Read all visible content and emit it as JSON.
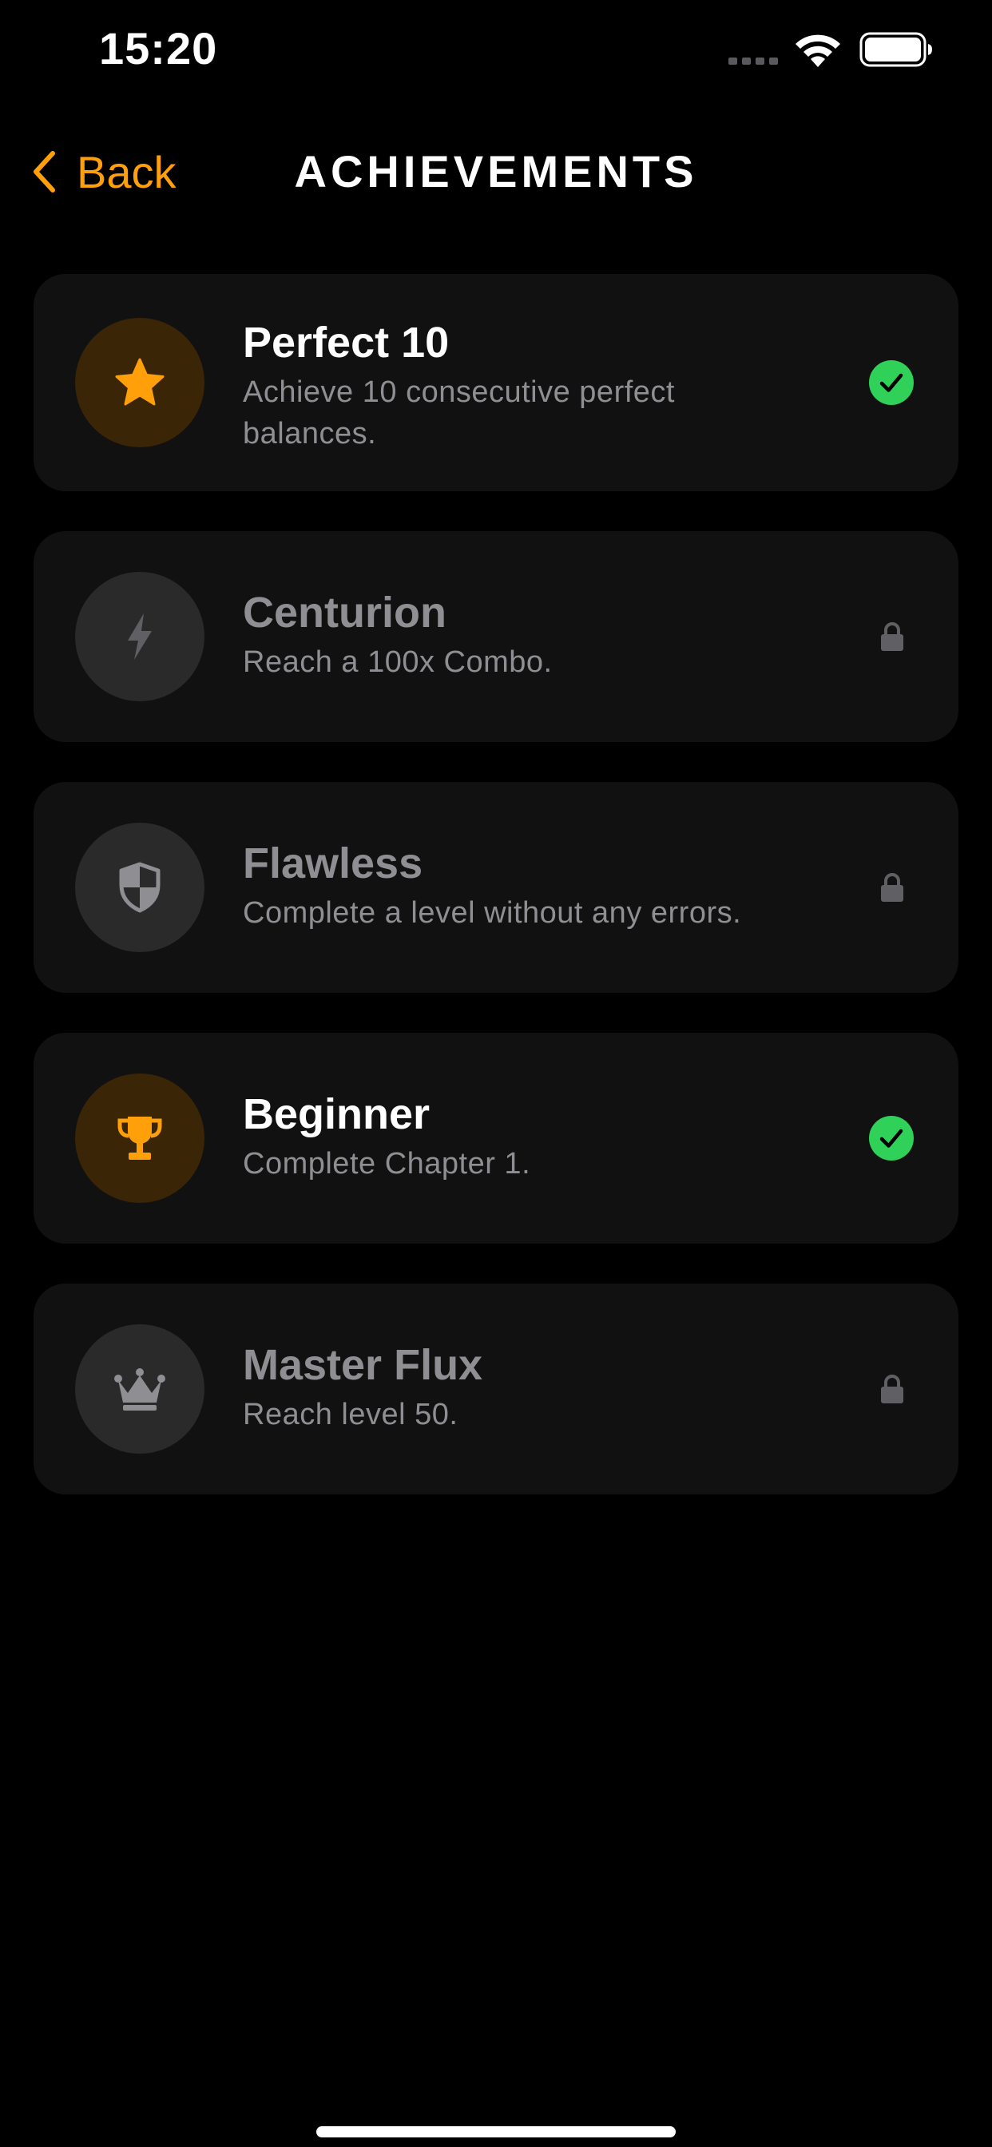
{
  "status_bar": {
    "time": "15:20",
    "icons": [
      "cellular-signal-icon",
      "wifi-icon",
      "battery-icon"
    ]
  },
  "nav": {
    "back_label": "Back",
    "back_icon": "chevron-left-icon",
    "title": "ACHIEVEMENTS"
  },
  "colors": {
    "accent": "#FF9F0A",
    "success": "#30D158",
    "locked_text": "#8E8E93",
    "card": "#111111",
    "background": "#000000"
  },
  "achievements": [
    {
      "title": "Perfect 10",
      "description": "Achieve 10 consecutive perfect balances.",
      "icon": "star-icon",
      "status": "unlocked",
      "status_icon": "checkmark-circle-icon"
    },
    {
      "title": "Centurion",
      "description": "Reach a 100x Combo.",
      "icon": "lightning-bolt-icon",
      "status": "locked",
      "status_icon": "lock-icon"
    },
    {
      "title": "Flawless",
      "description": "Complete a level without any errors.",
      "icon": "shield-icon",
      "status": "locked",
      "status_icon": "lock-icon"
    },
    {
      "title": "Beginner",
      "description": "Complete Chapter 1.",
      "icon": "trophy-icon",
      "status": "unlocked",
      "status_icon": "checkmark-circle-icon"
    },
    {
      "title": "Master Flux",
      "description": "Reach level 50.",
      "icon": "crown-icon",
      "status": "locked",
      "status_icon": "lock-icon"
    }
  ]
}
